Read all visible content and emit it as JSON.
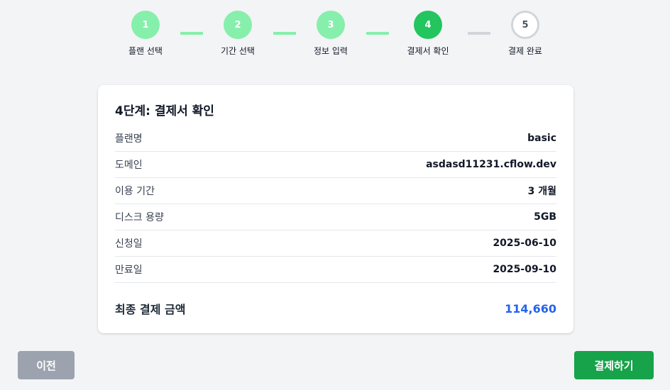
{
  "stepper": {
    "steps": [
      {
        "number": "1",
        "label": "플랜 선택",
        "state": "done"
      },
      {
        "number": "2",
        "label": "기간 선택",
        "state": "done"
      },
      {
        "number": "3",
        "label": "정보 입력",
        "state": "done"
      },
      {
        "number": "4",
        "label": "결제서 확인",
        "state": "active"
      },
      {
        "number": "5",
        "label": "결제 완료",
        "state": "pending"
      }
    ]
  },
  "card": {
    "title": "4단계: 결제서 확인",
    "rows": [
      {
        "label": "플랜명",
        "value": "basic"
      },
      {
        "label": "도메인",
        "value": "asdasd11231.cflow.dev"
      },
      {
        "label": "이용 기간",
        "value": "3 개월"
      },
      {
        "label": "디스크 용량",
        "value": "5GB"
      },
      {
        "label": "신청일",
        "value": "2025-06-10"
      },
      {
        "label": "만료일",
        "value": "2025-09-10"
      }
    ],
    "total_label": "최종 결제 금액",
    "total_value": "114,660"
  },
  "buttons": {
    "prev_label": "이전",
    "pay_label": "결제하기"
  },
  "colors": {
    "step_done": "#86efac",
    "step_active": "#22c55e",
    "step_pending_border": "#d1d5db",
    "total_amount": "#2563eb",
    "pay_button": "#16a34a",
    "prev_button": "#9ca3af"
  }
}
